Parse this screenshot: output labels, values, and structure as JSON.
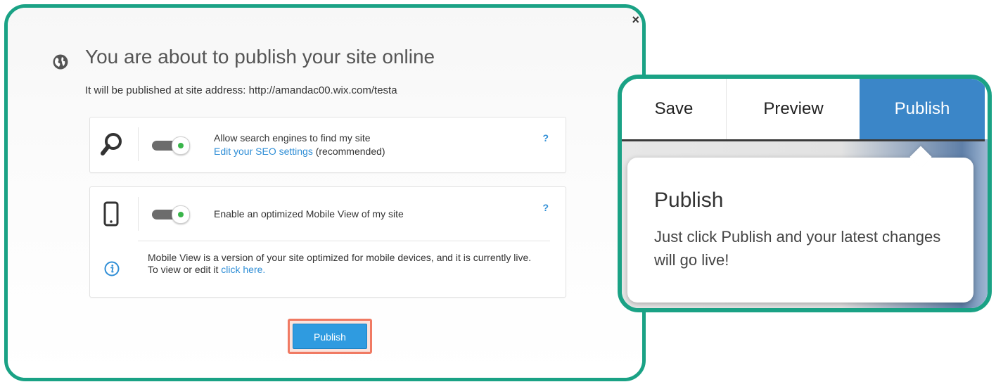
{
  "dialog": {
    "close_label": "×",
    "title": "You are about to publish your site online",
    "subtitle": "It will be published at site address: http://amandac00.wix.com/testa",
    "seo": {
      "line1": "Allow search engines to find my site",
      "link": "Edit your SEO settings",
      "suffix": " (recommended)",
      "help": "?",
      "icon": "search-icon",
      "toggle_on": true
    },
    "mobile": {
      "label": "Enable an optimized Mobile View of my site",
      "help": "?",
      "icon": "mobile-phone-icon",
      "toggle_on": true,
      "info_text": "Mobile View is a version of your site optimized for mobile devices, and it is currently live. To view or edit it ",
      "info_link": "click here."
    },
    "publish_button": "Publish"
  },
  "topbar": {
    "save": "Save",
    "preview": "Preview",
    "publish": "Publish"
  },
  "tooltip": {
    "title": "Publish",
    "body": "Just click Publish and your latest changes will go live!"
  },
  "colors": {
    "frame": "#1aa285",
    "accent_blue": "#3b86c8",
    "button_blue": "#2f9be0",
    "highlight": "#f07a63",
    "link": "#2f8ed6",
    "toggle_dot": "#39b54a"
  }
}
